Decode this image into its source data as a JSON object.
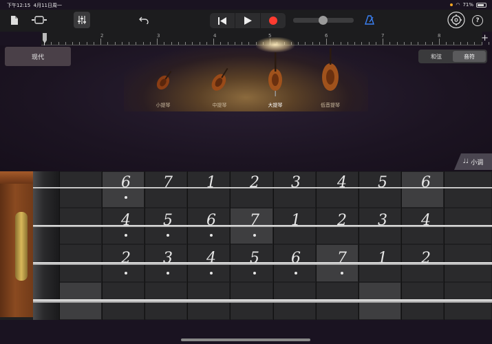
{
  "status": {
    "time": "下午12:15",
    "date": "4月11日周一",
    "battery": "71%"
  },
  "toolbar": {
    "icons": [
      "document-icon",
      "tracks-view-icon",
      "mixer-icon",
      "undo-icon",
      "rewind-icon",
      "play-icon",
      "record-icon",
      "metronome-icon",
      "settings-icon"
    ],
    "help": "?",
    "volume_level": 0.5
  },
  "ruler": {
    "bars": [
      "2",
      "3",
      "4",
      "5",
      "6",
      "7",
      "8"
    ],
    "add": "+"
  },
  "style_button": "现代",
  "mode": {
    "chords": "和弦",
    "notes": "音符",
    "selected": "notes"
  },
  "instruments": [
    {
      "label": "小提琴",
      "selected": false
    },
    {
      "label": "中提琴",
      "selected": false
    },
    {
      "label": "大提琴",
      "selected": true
    },
    {
      "label": "低音提琴",
      "selected": false
    }
  ],
  "scale_button": "小调",
  "colors": {
    "accent_record": "#ff3b30",
    "metronome": "#3b82f6"
  },
  "strings": [
    {
      "notes": [
        {
          "digit": "6",
          "dot": "below"
        },
        {
          "digit": "7",
          "dot": ""
        },
        {
          "digit": "1",
          "dot": ""
        },
        {
          "digit": "2",
          "dot": ""
        },
        {
          "digit": "3",
          "dot": ""
        },
        {
          "digit": "4",
          "dot": ""
        },
        {
          "digit": "5",
          "dot": ""
        },
        {
          "digit": "6",
          "dot": ""
        }
      ]
    },
    {
      "notes": [
        {
          "digit": "4",
          "dot": "below"
        },
        {
          "digit": "5",
          "dot": "below"
        },
        {
          "digit": "6",
          "dot": "below"
        },
        {
          "digit": "7",
          "dot": "below"
        },
        {
          "digit": "1",
          "dot": ""
        },
        {
          "digit": "2",
          "dot": ""
        },
        {
          "digit": "3",
          "dot": ""
        },
        {
          "digit": "4",
          "dot": ""
        }
      ]
    },
    {
      "notes": [
        {
          "digit": "2",
          "dot": "below"
        },
        {
          "digit": "3",
          "dot": "below"
        },
        {
          "digit": "4",
          "dot": "below"
        },
        {
          "digit": "5",
          "dot": "below"
        },
        {
          "digit": "6",
          "dot": "below"
        },
        {
          "digit": "7",
          "dot": "below"
        },
        {
          "digit": "1",
          "dot": ""
        },
        {
          "digit": "2",
          "dot": ""
        }
      ]
    },
    {
      "notes": []
    }
  ]
}
